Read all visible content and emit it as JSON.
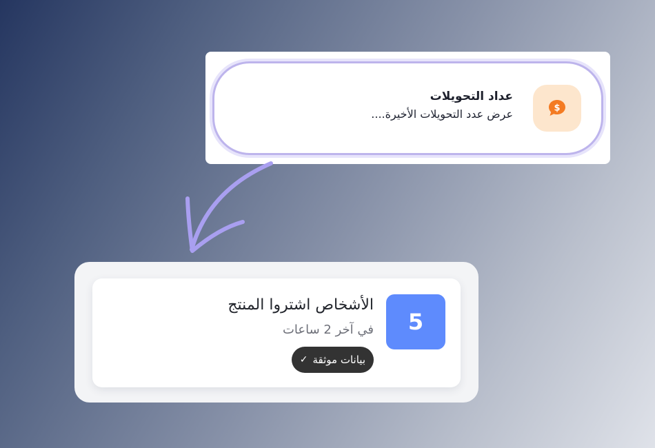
{
  "widget_option": {
    "title": "عداد التحويلات",
    "description": "عرض عدد التحويلات الأخيرة....",
    "icon": "dollar-chat-icon"
  },
  "arrow": {
    "icon": "curved-arrow-icon"
  },
  "preview": {
    "count": "5",
    "title": "الأشخاص اشتروا المنتج",
    "subtitle": "في آخر 2 ساعات",
    "badge": {
      "label": "بيانات موثقة",
      "check": "✓"
    }
  },
  "colors": {
    "accent_purple": "#a99ff0",
    "icon_orange": "#f47b22",
    "count_blue": "#5e8bfd",
    "badge_dark": "#333333"
  }
}
